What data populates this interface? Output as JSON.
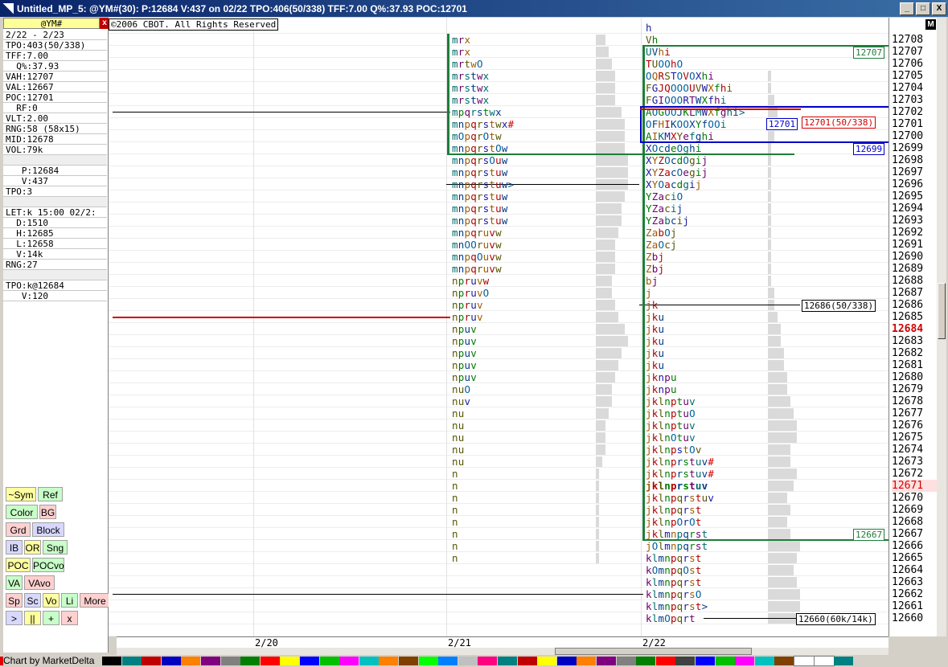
{
  "window": {
    "title": "Untitled_MP_5: @YM#(30): P:12684 V:437 on 02/22 TPO:406(50/338)  TFF:7.00 Q%:37.93 POC:12701",
    "buttons": [
      "_",
      "□",
      "X"
    ]
  },
  "sidebar": {
    "symbol": "@YM#",
    "rows": [
      "2/22 - 2/23",
      "TPO:403(50/338)",
      "TFF:7.00",
      "  Q%:37.93",
      "VAH:12707",
      "VAL:12667",
      "POC:12701",
      "  RF:0",
      "VLT:2.00",
      "RNG:58 (58x15)",
      "MID:12678",
      "VOL:79k",
      "",
      "   P:12684",
      "   V:437",
      "TPO:3",
      "",
      "LET:k 15:00 02/2:",
      "  D:1510",
      "  H:12685",
      "  L:12658",
      "  V:14k",
      "RNG:27",
      "",
      "TPO:k@12684",
      "   V:120"
    ],
    "toolbar": [
      [
        "~Sym",
        "Ref"
      ],
      [
        "Color",
        "BG"
      ],
      [
        "Grd",
        "Block"
      ],
      [
        "IB",
        "OR",
        "Sng"
      ],
      [
        "POC",
        "POCvo"
      ],
      [
        "VA",
        "VAvo"
      ],
      [
        "Sp",
        "Sc",
        "Vo",
        "Li",
        "More"
      ],
      [
        ">",
        "||",
        "+",
        "x"
      ]
    ]
  },
  "chart": {
    "copyright": "©2006 CBOT. All Rights Reserved",
    "x_labels": [
      "2/20",
      "2/21",
      "2/22"
    ],
    "price_ladder": [
      "12708",
      "12707",
      "12706",
      "12705",
      "12704",
      "12703",
      "12702",
      "12701",
      "12700",
      "12699",
      "12698",
      "12697",
      "12696",
      "12695",
      "12694",
      "12693",
      "12692",
      "12691",
      "12690",
      "12689",
      "12688",
      "12687",
      "12686",
      "12685",
      "12684",
      "12683",
      "12682",
      "12681",
      "12680",
      "12679",
      "12678",
      "12677",
      "12676",
      "12675",
      "12674",
      "12673",
      "12672",
      "12671",
      "12670",
      "12669",
      "12668",
      "12667",
      "12666",
      "12665",
      "12664",
      "12663",
      "12662",
      "12661",
      "12660"
    ],
    "top_price": "12708",
    "current_price": "12684",
    "highlight_price": "12671",
    "profile_0221": [
      {
        "p": 12708,
        "t": "mrx"
      },
      {
        "p": 12707,
        "t": "mrx"
      },
      {
        "p": 12706,
        "t": "mrtwO"
      },
      {
        "p": 12705,
        "t": "mrstwx"
      },
      {
        "p": 12704,
        "t": "mrstwx"
      },
      {
        "p": 12703,
        "t": "mrstwx"
      },
      {
        "p": 12702,
        "t": "mpqrstwx"
      },
      {
        "p": 12701,
        "t": "mnpqrstwx#"
      },
      {
        "p": 12700,
        "t": "mOpqrOtw"
      },
      {
        "p": 12699,
        "t": "mnpqrstOw"
      },
      {
        "p": 12698,
        "t": "mnpqrsOuw"
      },
      {
        "p": 12697,
        "t": "mnpqrstuw"
      },
      {
        "p": 12696,
        "t": "mnpqrstuw>"
      },
      {
        "p": 12695,
        "t": "mnpqrstuw"
      },
      {
        "p": 12694,
        "t": "mnpqrstuw"
      },
      {
        "p": 12693,
        "t": "mnpqrstuw"
      },
      {
        "p": 12692,
        "t": "mnpqruvw"
      },
      {
        "p": 12691,
        "t": "mnOOruvw"
      },
      {
        "p": 12690,
        "t": "mnpqOuvw"
      },
      {
        "p": 12689,
        "t": "mnpqruvw"
      },
      {
        "p": 12688,
        "t": "npruvw"
      },
      {
        "p": 12687,
        "t": "npruvO"
      },
      {
        "p": 12686,
        "t": "npruv"
      },
      {
        "p": 12685,
        "t": "npruv"
      },
      {
        "p": 12684,
        "t": "npuv"
      },
      {
        "p": 12683,
        "t": "npuv"
      },
      {
        "p": 12682,
        "t": "npuv"
      },
      {
        "p": 12681,
        "t": "npuv"
      },
      {
        "p": 12680,
        "t": "npuv"
      },
      {
        "p": 12679,
        "t": "nuO"
      },
      {
        "p": 12678,
        "t": "nuv"
      },
      {
        "p": 12677,
        "t": "nu"
      },
      {
        "p": 12676,
        "t": "nu"
      },
      {
        "p": 12675,
        "t": "nu"
      },
      {
        "p": 12674,
        "t": "nu"
      },
      {
        "p": 12673,
        "t": "nu"
      },
      {
        "p": 12672,
        "t": "n"
      },
      {
        "p": 12671,
        "t": "n"
      },
      {
        "p": 12670,
        "t": "n"
      },
      {
        "p": 12669,
        "t": "n"
      },
      {
        "p": 12668,
        "t": "n"
      },
      {
        "p": 12667,
        "t": "n"
      },
      {
        "p": 12666,
        "t": "n"
      },
      {
        "p": 12665,
        "t": "n"
      }
    ],
    "profile_0222": [
      {
        "p": 12709,
        "t": "h"
      },
      {
        "p": 12708,
        "t": "Vh"
      },
      {
        "p": 12707,
        "t": "UVhi"
      },
      {
        "p": 12706,
        "t": "TUOOhO"
      },
      {
        "p": 12705,
        "t": "OQRSTOVOXhi"
      },
      {
        "p": 12704,
        "t": "FGJQOOOUVWXfhi"
      },
      {
        "p": 12703,
        "t": "FGIOOORTWXfhi"
      },
      {
        "p": 12702,
        "t": "AOGOOJKLMWXfghi>"
      },
      {
        "p": 12701,
        "t": "OFHIKOOXYfOOi"
      },
      {
        "p": 12700,
        "t": "AIKMXYefghi"
      },
      {
        "p": 12699,
        "t": "XOcdeOghi"
      },
      {
        "p": 12698,
        "t": "XYZOcdOgij"
      },
      {
        "p": 12697,
        "t": "XYZacOegij"
      },
      {
        "p": 12696,
        "t": "XYOacdgij"
      },
      {
        "p": 12695,
        "t": "YZaciO"
      },
      {
        "p": 12694,
        "t": "YZacij"
      },
      {
        "p": 12693,
        "t": "YZabcij"
      },
      {
        "p": 12692,
        "t": "ZabOj"
      },
      {
        "p": 12691,
        "t": "ZaOcj"
      },
      {
        "p": 12690,
        "t": "Zbj"
      },
      {
        "p": 12689,
        "t": "Zbj"
      },
      {
        "p": 12688,
        "t": "bj"
      },
      {
        "p": 12687,
        "t": "j"
      },
      {
        "p": 12686,
        "t": "jk"
      },
      {
        "p": 12685,
        "t": "jku"
      },
      {
        "p": 12684,
        "t": "jku"
      },
      {
        "p": 12683,
        "t": "jku"
      },
      {
        "p": 12682,
        "t": "jku"
      },
      {
        "p": 12681,
        "t": "jku"
      },
      {
        "p": 12680,
        "t": "jknpu"
      },
      {
        "p": 12679,
        "t": "jknpu"
      },
      {
        "p": 12678,
        "t": "jklnptuv"
      },
      {
        "p": 12677,
        "t": "jklnptuO"
      },
      {
        "p": 12676,
        "t": "jklnptuv"
      },
      {
        "p": 12675,
        "t": "jklnOtuv"
      },
      {
        "p": 12674,
        "t": "jklnpstOv"
      },
      {
        "p": 12673,
        "t": "jklnprstuv#"
      },
      {
        "p": 12672,
        "t": "jklnprstuv#"
      },
      {
        "p": 12671,
        "t": "jklnprstuv"
      },
      {
        "p": 12670,
        "t": "jklnpqrstuv"
      },
      {
        "p": 12669,
        "t": "jklnpqrst"
      },
      {
        "p": 12668,
        "t": "jklnpOrOt"
      },
      {
        "p": 12667,
        "t": "jklmnpqrst"
      },
      {
        "p": 12666,
        "t": "jOlmnpqrst"
      },
      {
        "p": 12665,
        "t": "klmnpqrst"
      },
      {
        "p": 12664,
        "t": "kOmnpqOst"
      },
      {
        "p": 12663,
        "t": "klmnpqrst"
      },
      {
        "p": 12662,
        "t": "klmnpqrsO"
      },
      {
        "p": 12661,
        "t": "klmnpqrst>"
      },
      {
        "p": 12660,
        "t": "klmOpqrt"
      }
    ],
    "vol_0221": [
      3,
      4,
      5,
      6,
      6,
      6,
      8,
      9,
      9,
      9,
      10,
      10,
      10,
      9,
      8,
      8,
      7,
      6,
      6,
      6,
      5,
      5,
      6,
      7,
      9,
      10,
      8,
      7,
      6,
      5,
      5,
      4,
      3,
      3,
      3,
      2,
      1,
      1,
      1,
      1,
      1,
      1,
      1,
      1
    ],
    "vol_0222": [
      0,
      0,
      0,
      0,
      1,
      1,
      2,
      3,
      2,
      2,
      1,
      1,
      1,
      1,
      1,
      1,
      1,
      1,
      1,
      1,
      1,
      1,
      2,
      2,
      3,
      4,
      4,
      5,
      5,
      6,
      6,
      7,
      8,
      9,
      9,
      7,
      7,
      9,
      8,
      6,
      7,
      6,
      7,
      10,
      9,
      8,
      9,
      10,
      10,
      9
    ],
    "tags": {
      "vah": "12707",
      "val": "12667",
      "poc_box": "12701",
      "poc_label": "12701(50/338)",
      "lower_box": "12699",
      "mid_label": "12686(50/338)",
      "bottom_label": "12660(60k/14k)"
    },
    "colors": {
      "va_box": "#1e7d3a",
      "poc_box": "#0000c8",
      "poc_line": "#d00000",
      "period_lines": "#000000"
    }
  },
  "footer": {
    "credit": "Chart by MarketDelta",
    "palette": [
      "#000000",
      "#008080",
      "#c00000",
      "#0000c0",
      "#ff8000",
      "#800080",
      "#808080",
      "#008000",
      "#ff0000",
      "#ffff00",
      "#0000ff",
      "#00c000",
      "#ff00ff",
      "#00c0c0",
      "#ff8000",
      "#804000",
      "#00ff00",
      "#0080ff",
      "#c0c0c0",
      "#ff0080",
      "#008080",
      "#c00000",
      "#ffff00",
      "#0000c0",
      "#ff8000",
      "#800080",
      "#808080",
      "#008000",
      "#ff0000",
      "#404040",
      "#0000ff",
      "#00c000",
      "#ff00ff",
      "#00c0c0",
      "#804000",
      "#ffffff",
      "#ffffff",
      "#008080"
    ]
  }
}
